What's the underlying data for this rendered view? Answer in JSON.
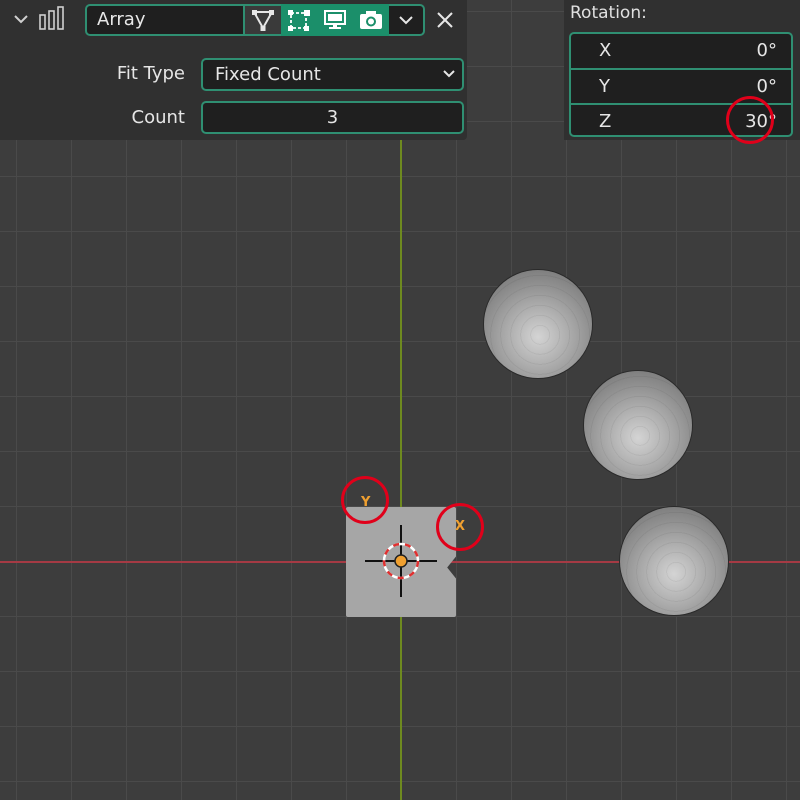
{
  "modifier": {
    "name": "Array",
    "fit_type_label": "Fit Type",
    "fit_type_value": "Fixed Count",
    "count_label": "Count",
    "count_value": "3",
    "icons": [
      "chevron-down-icon",
      "array-modifier-icon",
      "edit-mode-icon",
      "on-cage-icon",
      "realtime-display-icon",
      "render-camera-icon",
      "dropdown-arrow-icon",
      "close-icon"
    ]
  },
  "rotation": {
    "title": "Rotation:",
    "rows": [
      {
        "axis": "X",
        "value": "0°"
      },
      {
        "axis": "Y",
        "value": "0°"
      },
      {
        "axis": "Z",
        "value": "30°"
      }
    ]
  },
  "viewport": {
    "object_labels": {
      "y": "Y",
      "x": "X"
    },
    "colors": {
      "x_axis": "#a53a44",
      "y_axis": "#6e8a1f",
      "accent": "#2f8f72",
      "highlight_ring": "#e0001a",
      "axis_label": "#f0a030"
    }
  }
}
